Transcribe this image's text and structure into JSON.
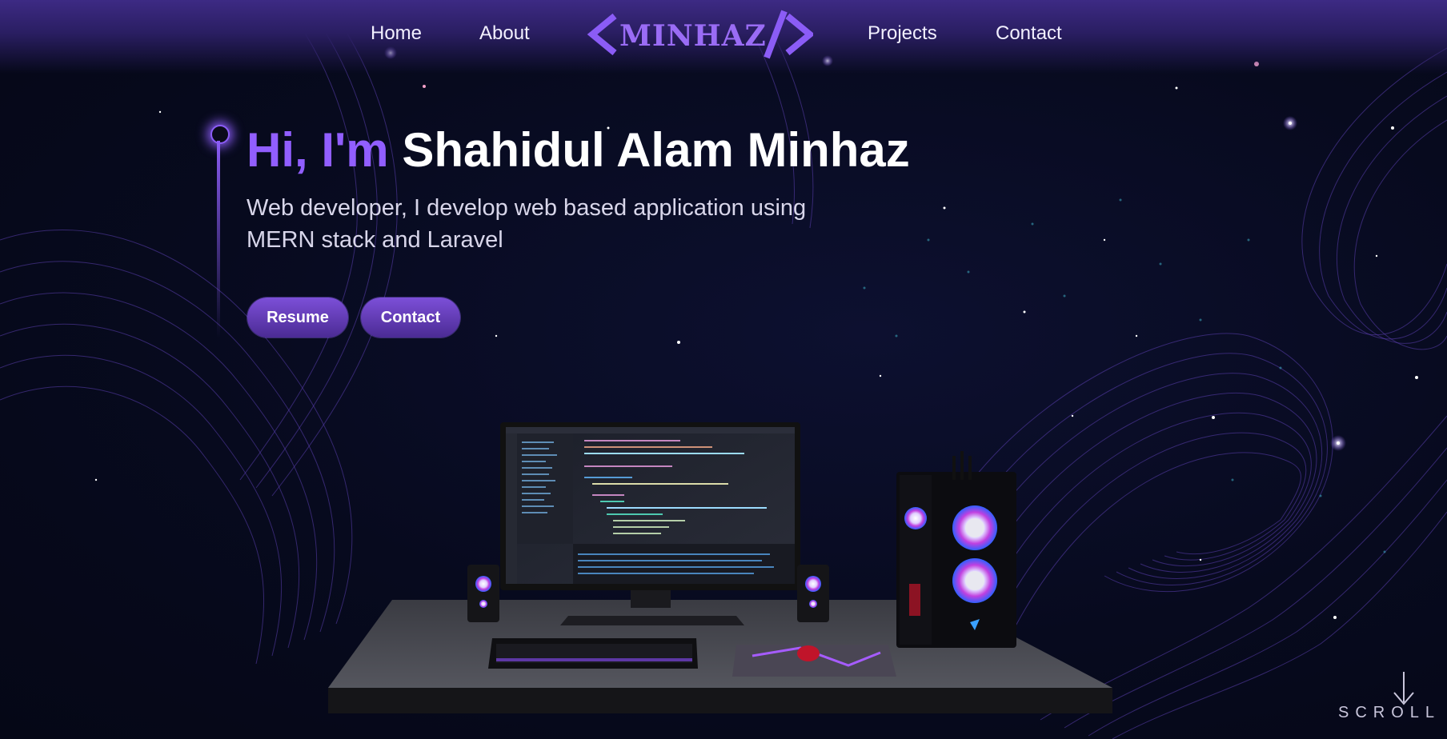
{
  "nav": {
    "links": [
      "Home",
      "About",
      "Projects",
      "Contact"
    ],
    "logo_text": "MINHAZ"
  },
  "hero": {
    "greeting": "Hi, I'm",
    "name": "Shahidul Alam Minhaz",
    "subtitle": "Web developer, I develop web based application using MERN stack and Laravel",
    "buttons": {
      "resume": "Resume",
      "contact": "Contact"
    }
  },
  "scroll": {
    "label": "SCROLL"
  },
  "colors": {
    "accent": "#915eff",
    "nav_bg": "#3d2a84",
    "button_bg": "#6a3fc4",
    "background": "#070a1e"
  },
  "icons": {
    "logo": "code-brackets-icon",
    "scroll": "arrow-down-icon"
  }
}
